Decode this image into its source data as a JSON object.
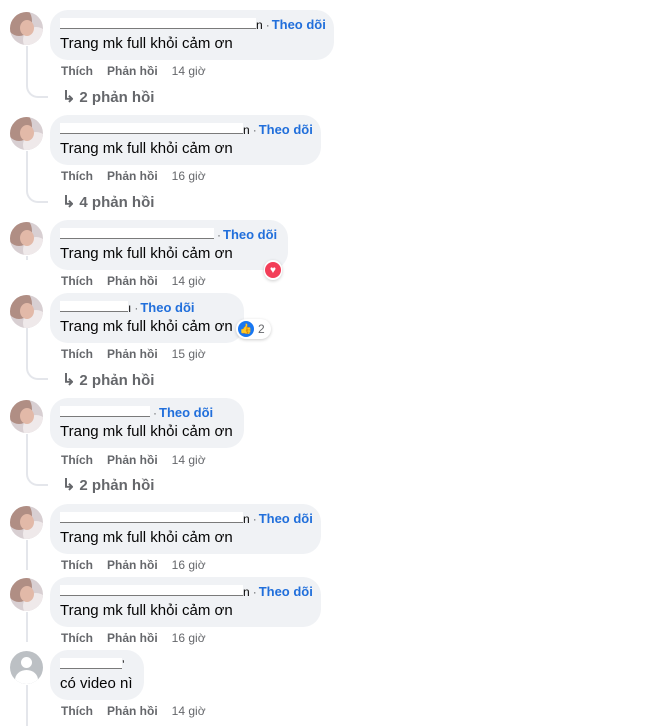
{
  "follow_label": "Theo dõi",
  "like_label": "Thích",
  "reply_label": "Phản hồi",
  "comments": [
    {
      "name_visible_end": "n",
      "text": "Trang mk full khỏi cảm ơn",
      "time": "14 giờ",
      "replies": "2 phản hồi"
    },
    {
      "name_visible_end": "n",
      "text": "Trang mk full khỏi cảm ơn",
      "time": "16 giờ",
      "replies": "4 phản hồi"
    },
    {
      "name_visible_end": "",
      "text": "Trang mk full khỏi cảm ơn",
      "time": "14 giờ",
      "reaction": {
        "type": "love",
        "count": ""
      }
    },
    {
      "name_visible_end": "ı",
      "text": "Trang mk full khỏi cảm ơn",
      "time": "15 giờ",
      "replies": "2 phản hồi",
      "reaction": {
        "type": "like",
        "count": "2"
      }
    },
    {
      "name_visible_end": "",
      "text": "Trang mk full khỏi cảm ơn",
      "time": "14 giờ",
      "replies": "2 phản hồi"
    },
    {
      "name_visible_end": "n",
      "text": "Trang mk full khỏi cảm ơn",
      "time": "16 giờ"
    },
    {
      "name_visible_end": "n",
      "text": "Trang mk full khỏi cảm ơn",
      "time": "16 giờ"
    },
    {
      "name_visible_end": "ʼ",
      "text": "có video nì",
      "time": "14 giờ"
    }
  ],
  "icons": {
    "reply_arrow": "reply-arrow-icon",
    "love": "heart-reaction-icon",
    "like": "thumbs-up-reaction-icon"
  },
  "colors": {
    "follow": "#216fdb",
    "bubble": "#f0f2f5",
    "meta": "#65676b",
    "love": "#f33e58",
    "like": "#1877f2"
  }
}
